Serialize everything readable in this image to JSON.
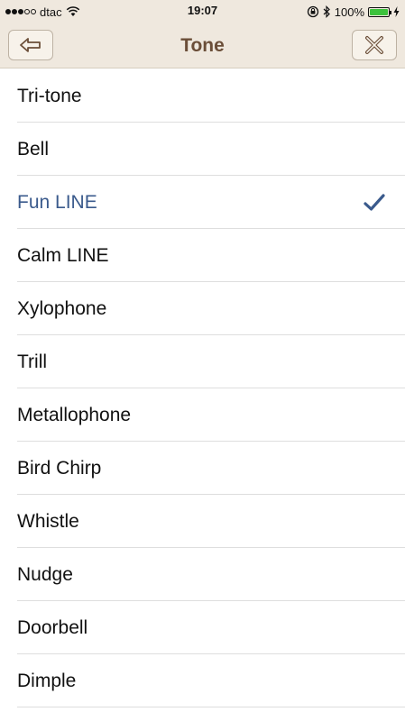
{
  "status_bar": {
    "carrier": "dtac",
    "time": "19:07",
    "battery_percent": "100%",
    "battery_level": 1.0,
    "icons": [
      "signal-icon",
      "wifi-icon",
      "orientation-lock-icon",
      "bluetooth-icon",
      "battery-icon",
      "charging-icon"
    ]
  },
  "nav": {
    "title": "Tone",
    "back_icon": "back-arrow-icon",
    "close_icon": "close-icon"
  },
  "colors": {
    "nav_background": "#efe8de",
    "title_color": "#6b4e38",
    "selected_color": "#3a5a8c",
    "separator": "#dedede"
  },
  "tones": [
    {
      "label": "Tri-tone",
      "selected": false
    },
    {
      "label": "Bell",
      "selected": false
    },
    {
      "label": "Fun LINE",
      "selected": true
    },
    {
      "label": "Calm LINE",
      "selected": false
    },
    {
      "label": "Xylophone",
      "selected": false
    },
    {
      "label": "Trill",
      "selected": false
    },
    {
      "label": "Metallophone",
      "selected": false
    },
    {
      "label": "Bird Chirp",
      "selected": false
    },
    {
      "label": "Whistle",
      "selected": false
    },
    {
      "label": "Nudge",
      "selected": false
    },
    {
      "label": "Doorbell",
      "selected": false
    },
    {
      "label": "Dimple",
      "selected": false
    }
  ]
}
